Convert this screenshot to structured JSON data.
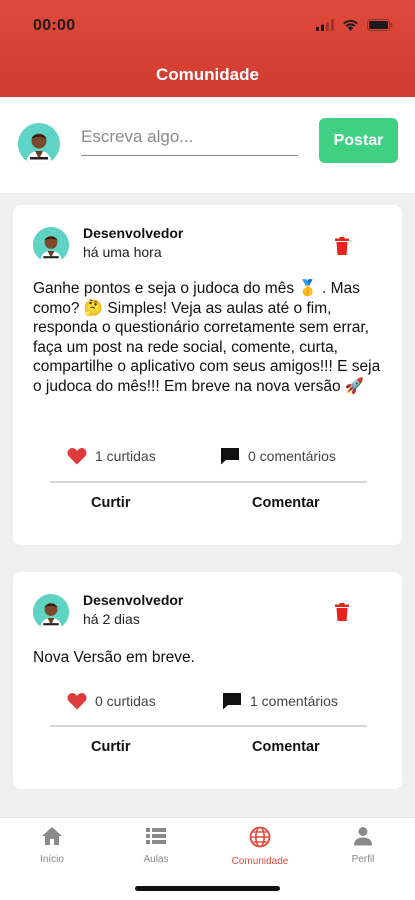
{
  "status_bar": {
    "time": "00:00"
  },
  "header": {
    "title": "Comunidade"
  },
  "composer": {
    "placeholder": "Escreva algo...",
    "post_label": "Postar"
  },
  "posts": [
    {
      "author": "Desenvolvedor",
      "time": "há uma hora",
      "text": "Ganhe pontos e seja o judoca do mês 🥇 . Mas como? 🤔      Simples! Veja as aulas até o fim, responda o questionário corretamente sem errar, faça um post na rede social, comente, curta, compartilhe o aplicativo com seus amigos!!! E seja o judoca do mês!!! Em breve na nova versão 🚀",
      "likes": "1 curtidas",
      "comments": "0 comentários",
      "like_label": "Curtir",
      "comment_label": "Comentar"
    },
    {
      "author": "Desenvolvedor",
      "time": "há 2 dias",
      "text": "Nova Versão em breve.",
      "likes": "0 curtidas",
      "comments": "1 comentários",
      "like_label": "Curtir",
      "comment_label": "Comentar"
    }
  ],
  "bottom_nav": [
    {
      "label": "Início",
      "icon": "home-icon"
    },
    {
      "label": "Aulas",
      "icon": "list-icon"
    },
    {
      "label": "Comunidade",
      "icon": "globe-icon",
      "active": true
    },
    {
      "label": "Perfil",
      "icon": "person-icon"
    }
  ],
  "colors": {
    "brand": "#e04a3c",
    "post_button": "#3fd083",
    "trash": "#e8221c",
    "like": "#e03b3b"
  }
}
